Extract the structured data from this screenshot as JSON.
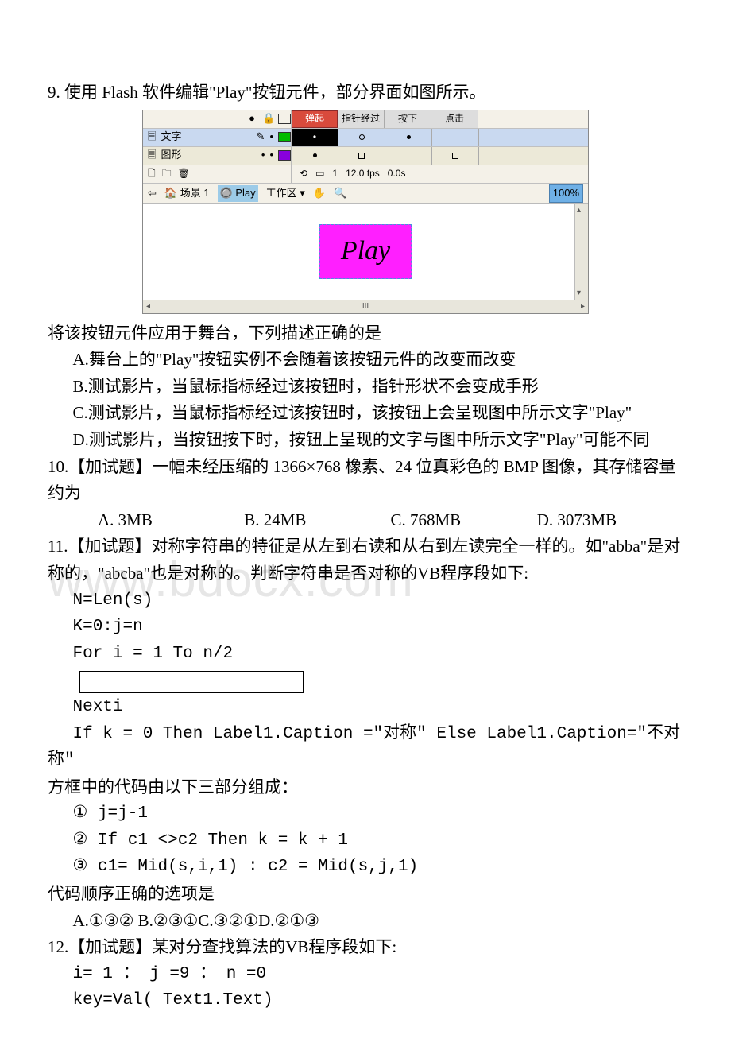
{
  "q9": {
    "prompt": "9. 使用 Flash 软件编辑\"Play\"按钮元件，部分界面如图所示。",
    "after_image": "将该按钮元件应用于舞台，下列描述正确的是",
    "opts": {
      "A": "A.舞台上的\"Play\"按钮实例不会随着该按钮元件的改变而改变",
      "B": "B.测试影片，当鼠标指标经过该按钮时，指针形状不会变成手形",
      "C": "C.测试影片，当鼠标指标经过该按钮时，该按钮上会呈现图中所示文字\"Play\"",
      "D": "D.测试影片，当按钮按下时，按钮上呈现的文字与图中所示文字\"Play\"可能不同"
    }
  },
  "flash": {
    "states": [
      "弹起",
      "指针经过",
      "按下",
      "点击"
    ],
    "layer1": "文字",
    "layer2": "图形",
    "tools_frame": "1",
    "tools_fps": "12.0 fps",
    "tools_time": "0.0s",
    "scene": "场景 1",
    "symbol": "Play",
    "workarea": "工作区 ▾",
    "zoom": "100%",
    "playtext": "Play"
  },
  "q10": {
    "prompt": "10.【加试题】一幅未经压缩的 1366×768 橡素、24 位真彩色的 BMP 图像，其存储容量约为",
    "A": "A. 3MB",
    "B": "B. 24MB",
    "C": "C. 768MB",
    "D": "D. 3073MB"
  },
  "q11": {
    "prompt": "11.【加试题】对称字符串的特征是从左到右读和从右到左读完全一样的。如\"abba\"是对称的，\"abcba\"也是对称的。判断字符串是否对称的VB程序段如下:",
    "c1": "N=Len(s)",
    "c2": "K=0:j=n",
    "c3": "For i = 1 To  n/2",
    "c4": "Nexti",
    "c5": "If k = 0 Then Label1.Caption =\"对称\"  Else Label1.Caption=\"不对称\"",
    "framing": "方框中的代码由以下三部分组成：",
    "p1": "① j=j-1",
    "p2": "② If c1 <>c2 Then k = k + 1",
    "p3": "③ c1= Mid(s,i,1) : c2 = Mid(s,j,1)",
    "order_q": "代码顺序正确的选项是",
    "opts": "A.①③② B.②③①C.③②①D.②①③"
  },
  "q12": {
    "prompt": "12.【加试题】某对分查找算法的VB程序段如下:",
    "c1": "i= 1 ：  j =9 ： n =0",
    "c2": "key=Val( Text1.Text)"
  },
  "watermark": "www.bdocx.com"
}
